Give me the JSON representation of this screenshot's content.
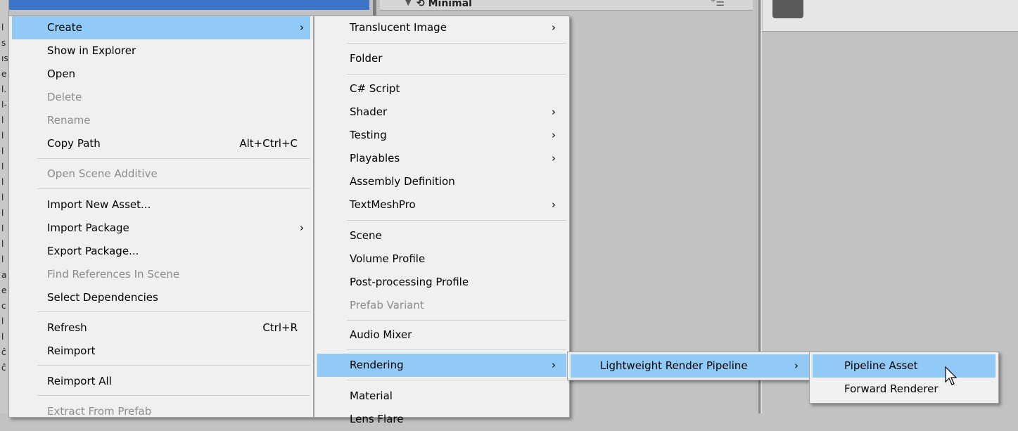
{
  "background": {
    "hierarchy_scene": "Minimal",
    "left_strip_glyphs": [
      "l",
      "s",
      "ıs",
      "e",
      "l.",
      "l-",
      "l",
      "l",
      "l",
      "l",
      "l",
      "l",
      "l",
      "l",
      "l",
      "l",
      "a",
      "e",
      "c",
      "l",
      "l",
      "ĉ",
      "ĉ"
    ]
  },
  "main_menu": {
    "items": [
      {
        "label": "Create",
        "shortcut": "",
        "submenu": true,
        "disabled": false,
        "highlighted": true
      },
      {
        "label": "Show in Explorer",
        "shortcut": "",
        "submenu": false,
        "disabled": false
      },
      {
        "label": "Open",
        "shortcut": "",
        "submenu": false,
        "disabled": false
      },
      {
        "label": "Delete",
        "shortcut": "",
        "submenu": false,
        "disabled": true
      },
      {
        "label": "Rename",
        "shortcut": "",
        "submenu": false,
        "disabled": true
      },
      {
        "label": "Copy Path",
        "shortcut": "Alt+Ctrl+C",
        "submenu": false,
        "disabled": false
      },
      {
        "label": "Open Scene Additive",
        "shortcut": "",
        "submenu": false,
        "disabled": true
      },
      {
        "label": "Import New Asset...",
        "shortcut": "",
        "submenu": false,
        "disabled": false
      },
      {
        "label": "Import Package",
        "shortcut": "",
        "submenu": true,
        "disabled": false
      },
      {
        "label": "Export Package...",
        "shortcut": "",
        "submenu": false,
        "disabled": false
      },
      {
        "label": "Find References In Scene",
        "shortcut": "",
        "submenu": false,
        "disabled": true
      },
      {
        "label": "Select Dependencies",
        "shortcut": "",
        "submenu": false,
        "disabled": false
      },
      {
        "label": "Refresh",
        "shortcut": "Ctrl+R",
        "submenu": false,
        "disabled": false
      },
      {
        "label": "Reimport",
        "shortcut": "",
        "submenu": false,
        "disabled": false
      },
      {
        "label": "Reimport All",
        "shortcut": "",
        "submenu": false,
        "disabled": false
      },
      {
        "label": "Extract From Prefab",
        "shortcut": "",
        "submenu": false,
        "disabled": true
      }
    ]
  },
  "create_menu": {
    "items": [
      {
        "label": "Translucent Image",
        "submenu": true,
        "disabled": false
      },
      {
        "label": "Folder",
        "submenu": false,
        "disabled": false
      },
      {
        "label": "C# Script",
        "submenu": false,
        "disabled": false
      },
      {
        "label": "Shader",
        "submenu": true,
        "disabled": false
      },
      {
        "label": "Testing",
        "submenu": true,
        "disabled": false
      },
      {
        "label": "Playables",
        "submenu": true,
        "disabled": false
      },
      {
        "label": "Assembly Definition",
        "submenu": false,
        "disabled": false
      },
      {
        "label": "TextMeshPro",
        "submenu": true,
        "disabled": false
      },
      {
        "label": "Scene",
        "submenu": false,
        "disabled": false
      },
      {
        "label": "Volume Profile",
        "submenu": false,
        "disabled": false
      },
      {
        "label": "Post-processing Profile",
        "submenu": false,
        "disabled": false
      },
      {
        "label": "Prefab Variant",
        "submenu": false,
        "disabled": true
      },
      {
        "label": "Audio Mixer",
        "submenu": false,
        "disabled": false
      },
      {
        "label": "Rendering",
        "submenu": true,
        "disabled": false,
        "highlighted": true
      },
      {
        "label": "Material",
        "submenu": false,
        "disabled": false
      },
      {
        "label": "Lens Flare",
        "submenu": false,
        "disabled": false
      }
    ]
  },
  "rendering_menu": {
    "items": [
      {
        "label": "Lightweight Render Pipeline",
        "submenu": true,
        "highlighted": true
      }
    ]
  },
  "lrp_menu": {
    "items": [
      {
        "label": "Pipeline Asset",
        "highlighted": true
      },
      {
        "label": "Forward Renderer",
        "highlighted": false
      }
    ]
  },
  "glyphs": {
    "submenu_arrow": "›",
    "panel_menu": "⁺☰",
    "triangle": "▼",
    "scene_icon": "⟲"
  },
  "colors": {
    "highlight": "#91c9f7",
    "menu_bg": "#f0f0f0",
    "disabled_text": "#8c8c8c"
  }
}
